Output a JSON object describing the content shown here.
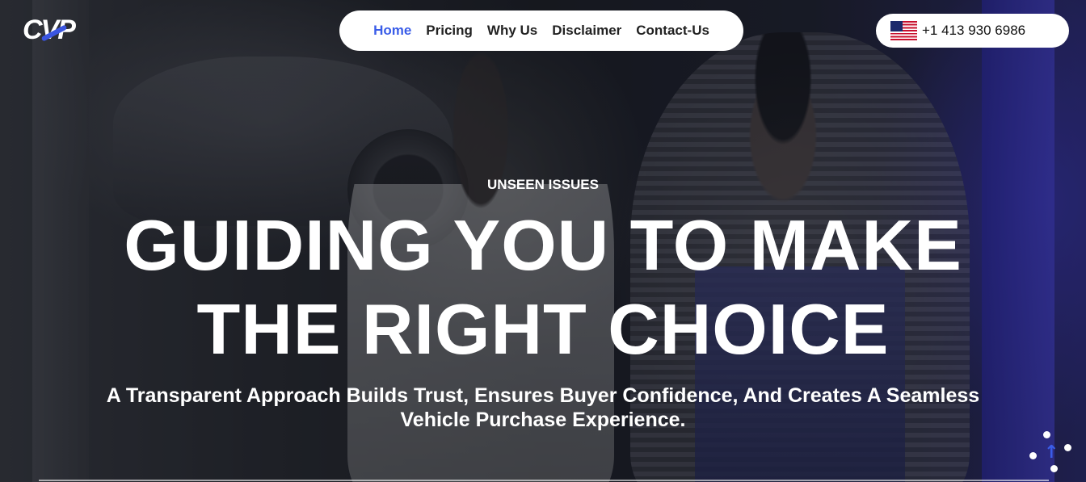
{
  "brand": {
    "logo_text": "CVP"
  },
  "nav": {
    "items": [
      {
        "label": "Home",
        "active": true
      },
      {
        "label": "Pricing",
        "active": false
      },
      {
        "label": "Why Us",
        "active": false
      },
      {
        "label": "Disclaimer",
        "active": false
      },
      {
        "label": "Contact-Us",
        "active": false
      }
    ]
  },
  "contact": {
    "phone": "+1 413 930 6986",
    "flag_icon": "us-flag-icon"
  },
  "hero": {
    "eyebrow": "UNSEEN ISSUES",
    "headline_line1": "GUIDING YOU TO MAKE",
    "headline_line2": "THE RIGHT CHOICE",
    "subhead_line1": "A Transparent Approach Builds Trust, Ensures Buyer Confidence, And Creates A Seamless",
    "subhead_line2": "Vehicle Purchase Experience."
  },
  "colors": {
    "accent": "#3a5de8",
    "text": "#ffffff",
    "nav_text": "#222222"
  },
  "scroll_top": {
    "icon": "arrow-up-icon"
  }
}
